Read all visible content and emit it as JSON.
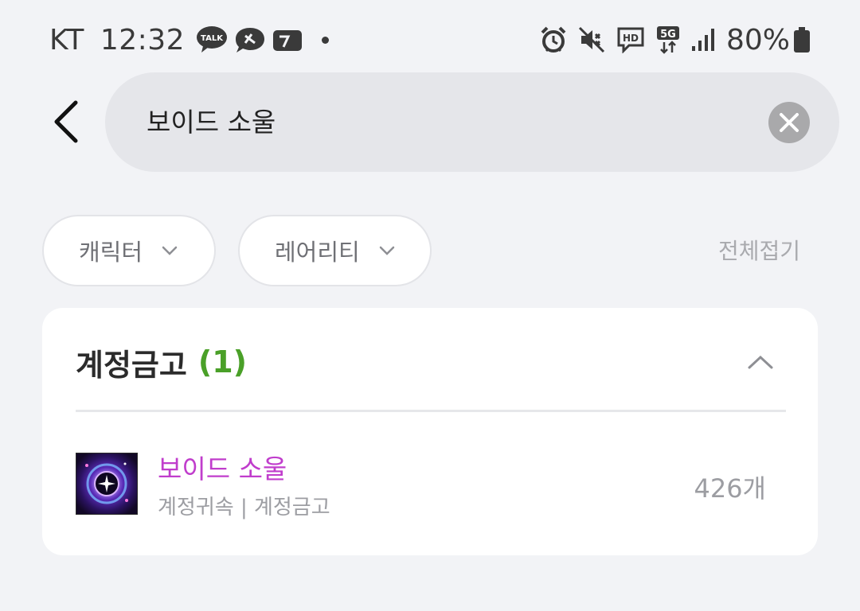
{
  "status_bar": {
    "carrier": "KT",
    "time": "12:32",
    "battery_percent": "80%",
    "talk_badge": "TALK",
    "hd_badge": "HD",
    "network_badge": "5G",
    "left_icons": [
      "kakaotalk-icon",
      "chat-bubble-icon",
      "calendar-app-icon",
      "notification-dot-icon"
    ],
    "right_icons": [
      "alarm-icon",
      "mute-icon",
      "hd-voice-icon",
      "5g-data-icon",
      "signal-icon",
      "battery-icon"
    ]
  },
  "search": {
    "query": "보이드 소울",
    "back_icon": "back-arrow-icon",
    "clear_icon": "clear-icon"
  },
  "filters": {
    "character_label": "캐릭터",
    "rarity_label": "레어리티",
    "collapse_all_label": "전체접기"
  },
  "section": {
    "title": "계정금고",
    "count": "(1)",
    "count_color": "#4aa028"
  },
  "items": [
    {
      "name": "보이드 소울",
      "tags": "계정귀속 | 계정금고",
      "quantity": "426개",
      "name_color": "#c03dcc",
      "icon": "void-soul-icon"
    }
  ],
  "colors": {
    "background": "#f2f3f6",
    "search_bg": "#e5e6ea",
    "card_bg": "#ffffff"
  }
}
